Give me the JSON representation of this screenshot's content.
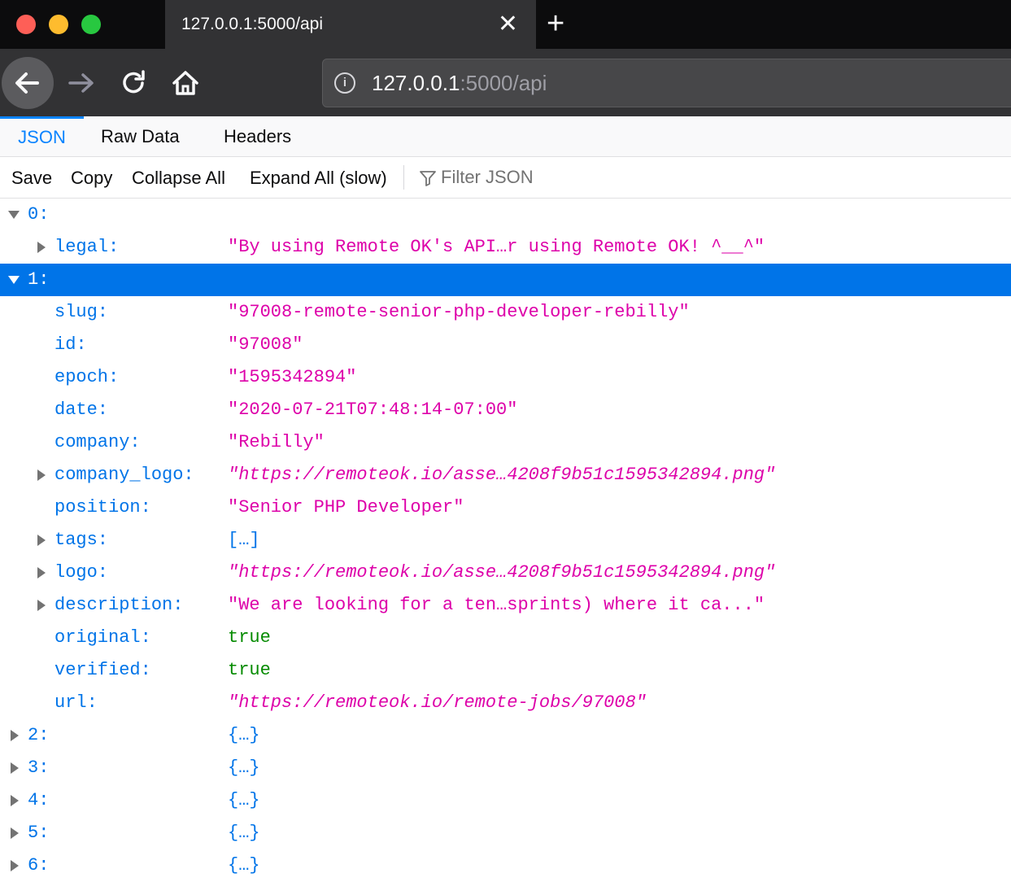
{
  "browser": {
    "tab_title": "127.0.0.1:5000/api",
    "close_tab_glyph": "✕",
    "new_tab_glyph": "+",
    "url_host": "127.0.0.1",
    "url_rest": ":5000/api",
    "icons": {
      "back": "arrow-left-icon",
      "forward": "arrow-right-icon",
      "reload": "reload-icon",
      "home": "home-icon",
      "info": "info-icon"
    }
  },
  "viewer": {
    "tabs": [
      {
        "label": "JSON",
        "active": true
      },
      {
        "label": "Raw Data",
        "active": false
      },
      {
        "label": "Headers",
        "active": false
      }
    ],
    "toolbar": {
      "save": "Save",
      "copy": "Copy",
      "collapse_all": "Collapse All",
      "expand_all": "Expand All (slow)",
      "filter_placeholder": "Filter JSON"
    }
  },
  "colors": {
    "key": "#0074e8",
    "string": "#dd00a9",
    "bool": "#058b00",
    "selected_row": "#0074e8"
  },
  "tree": [
    {
      "key": "0:",
      "value": "",
      "twisty": "down",
      "level": 0,
      "type": "none",
      "selected": false
    },
    {
      "key": "legal:",
      "value": "\"By using Remote OK's API…r using Remote OK! ^__^\"",
      "twisty": "right",
      "level": 1,
      "type": "string",
      "selected": false
    },
    {
      "key": "1:",
      "value": "",
      "twisty": "down",
      "level": 0,
      "type": "none",
      "selected": true
    },
    {
      "key": "slug:",
      "value": "\"97008-remote-senior-php-developer-rebilly\"",
      "twisty": "none",
      "level": 1,
      "type": "string",
      "selected": false
    },
    {
      "key": "id:",
      "value": "\"97008\"",
      "twisty": "none",
      "level": 1,
      "type": "string",
      "selected": false
    },
    {
      "key": "epoch:",
      "value": "\"1595342894\"",
      "twisty": "none",
      "level": 1,
      "type": "string",
      "selected": false
    },
    {
      "key": "date:",
      "value": "\"2020-07-21T07:48:14-07:00\"",
      "twisty": "none",
      "level": 1,
      "type": "string",
      "selected": false
    },
    {
      "key": "company:",
      "value": "\"Rebilly\"",
      "twisty": "none",
      "level": 1,
      "type": "string",
      "selected": false
    },
    {
      "key": "company_logo:",
      "value": "\"https://remoteok.io/asse…4208f9b51c1595342894.png\"",
      "twisty": "right",
      "level": 1,
      "type": "url",
      "selected": false
    },
    {
      "key": "position:",
      "value": "\"Senior PHP Developer\"",
      "twisty": "none",
      "level": 1,
      "type": "string",
      "selected": false
    },
    {
      "key": "tags:",
      "value": "[…]",
      "twisty": "right",
      "level": 1,
      "type": "object",
      "selected": false
    },
    {
      "key": "logo:",
      "value": "\"https://remoteok.io/asse…4208f9b51c1595342894.png\"",
      "twisty": "right",
      "level": 1,
      "type": "url",
      "selected": false
    },
    {
      "key": "description:",
      "value": "\"We are looking for a ten…sprints) where it ca...\"",
      "twisty": "right",
      "level": 1,
      "type": "string",
      "selected": false
    },
    {
      "key": "original:",
      "value": "true",
      "twisty": "none",
      "level": 1,
      "type": "bool",
      "selected": false
    },
    {
      "key": "verified:",
      "value": "true",
      "twisty": "none",
      "level": 1,
      "type": "bool",
      "selected": false
    },
    {
      "key": "url:",
      "value": "\"https://remoteok.io/remote-jobs/97008\"",
      "twisty": "none",
      "level": 1,
      "type": "url",
      "selected": false
    },
    {
      "key": "2:",
      "value": "{…}",
      "twisty": "right",
      "level": 0,
      "type": "object",
      "selected": false
    },
    {
      "key": "3:",
      "value": "{…}",
      "twisty": "right",
      "level": 0,
      "type": "object",
      "selected": false
    },
    {
      "key": "4:",
      "value": "{…}",
      "twisty": "right",
      "level": 0,
      "type": "object",
      "selected": false
    },
    {
      "key": "5:",
      "value": "{…}",
      "twisty": "right",
      "level": 0,
      "type": "object",
      "selected": false
    },
    {
      "key": "6:",
      "value": "{…}",
      "twisty": "right",
      "level": 0,
      "type": "object",
      "selected": false
    }
  ]
}
